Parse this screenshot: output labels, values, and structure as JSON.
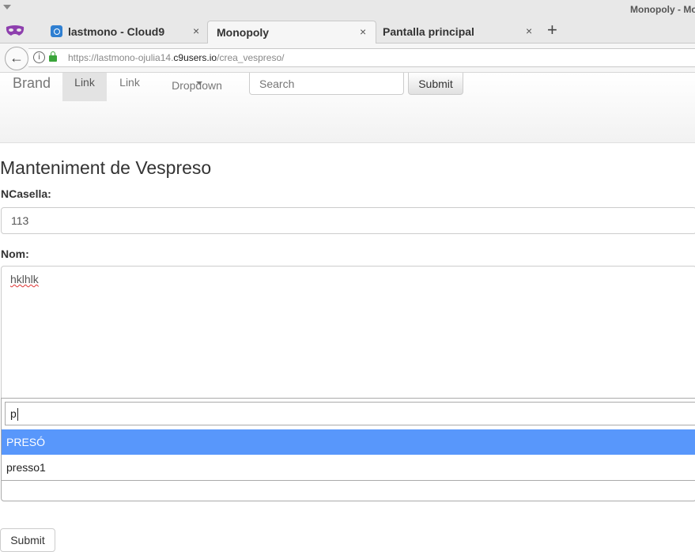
{
  "window": {
    "title": "Monopoly - Mo"
  },
  "tabs": [
    {
      "label": "lastmono - Cloud9",
      "icon": "cloud9-icon",
      "close": "×"
    },
    {
      "label": "Monopoly",
      "close": "×",
      "active": true
    },
    {
      "label": "Pantalla principal",
      "close": "×"
    }
  ],
  "new_tab_label": "+",
  "address": {
    "prefix": "https://lastmono-ojulia14.",
    "domain": "c9users.io",
    "path": "/crea_vespreso/"
  },
  "navbar": {
    "brand": "Brand",
    "links": [
      "Link",
      "Link"
    ],
    "dropdown": "Dropdown",
    "search_placeholder": "Search",
    "submit_label": "Submit"
  },
  "form": {
    "title": "Manteniment de Vespreso",
    "ncasella_label": "NCasella:",
    "ncasella_value": "113",
    "nom_label": "Nom:",
    "nom_value": "hklhlk",
    "dropdown_search": "p",
    "options": [
      "PRESÓ",
      "presso1"
    ],
    "highlighted_option": "PRESÓ",
    "submit_label": "Submit"
  },
  "colors": {
    "highlight": "#5897fb",
    "lock": "#3aa53a"
  }
}
